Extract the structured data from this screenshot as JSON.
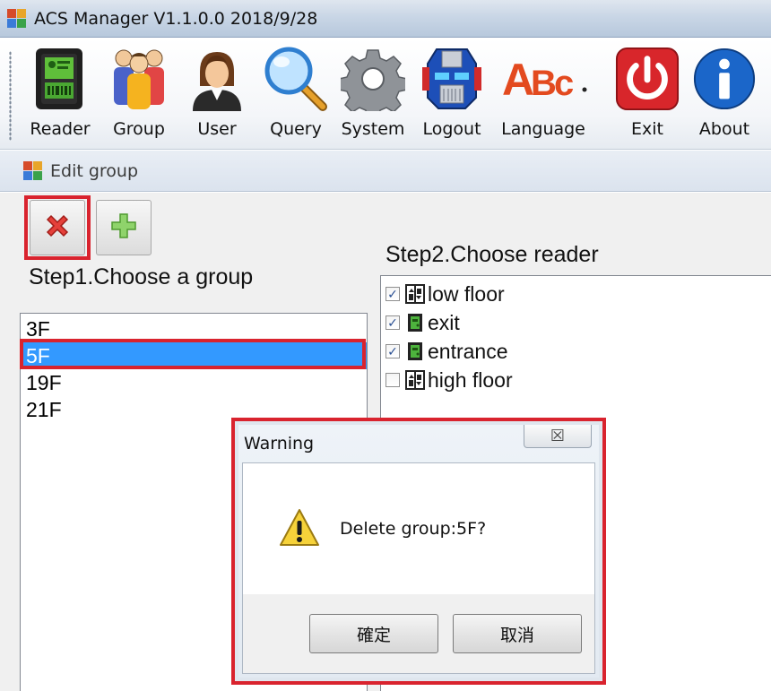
{
  "window": {
    "title": "ACS Manager V1.1.0.0  2018/9/28"
  },
  "toolbar": {
    "items": [
      {
        "label": "Reader",
        "icon": "reader-device-icon"
      },
      {
        "label": "Group",
        "icon": "group-people-icon"
      },
      {
        "label": "User",
        "icon": "user-icon"
      },
      {
        "label": "Query",
        "icon": "magnifier-icon"
      },
      {
        "label": "System",
        "icon": "gear-icon"
      },
      {
        "label": "Logout",
        "icon": "robot-head-icon"
      },
      {
        "label": "Language",
        "icon": "abc-language-icon"
      },
      {
        "label": "Exit",
        "icon": "power-icon"
      },
      {
        "label": "About",
        "icon": "info-icon"
      }
    ]
  },
  "form": {
    "title": "Edit group",
    "delete_button_icon": "red-x-icon",
    "add_button_icon": "green-plus-icon",
    "step1_label": "Step1.Choose a group",
    "step2_label": "Step2.Choose reader",
    "groups": [
      "3F",
      "5F",
      "19F",
      "21F"
    ],
    "selected_group": "5F",
    "readers": [
      {
        "label": "low floor",
        "checked": true,
        "icon": "elevator-icon"
      },
      {
        "label": "exit",
        "checked": true,
        "icon": "door-icon"
      },
      {
        "label": "entrance",
        "checked": true,
        "icon": "door-icon"
      },
      {
        "label": "high floor",
        "checked": false,
        "icon": "elevator-icon"
      }
    ]
  },
  "dialog": {
    "title": "Warning",
    "close_glyph": "☒",
    "message": "Delete group:5F?",
    "ok_label": "確定",
    "cancel_label": "取消"
  },
  "colors": {
    "highlight": "#d9232e",
    "selection": "#3399ff",
    "exit_red": "#d8262b",
    "about_blue": "#1b66c9"
  }
}
